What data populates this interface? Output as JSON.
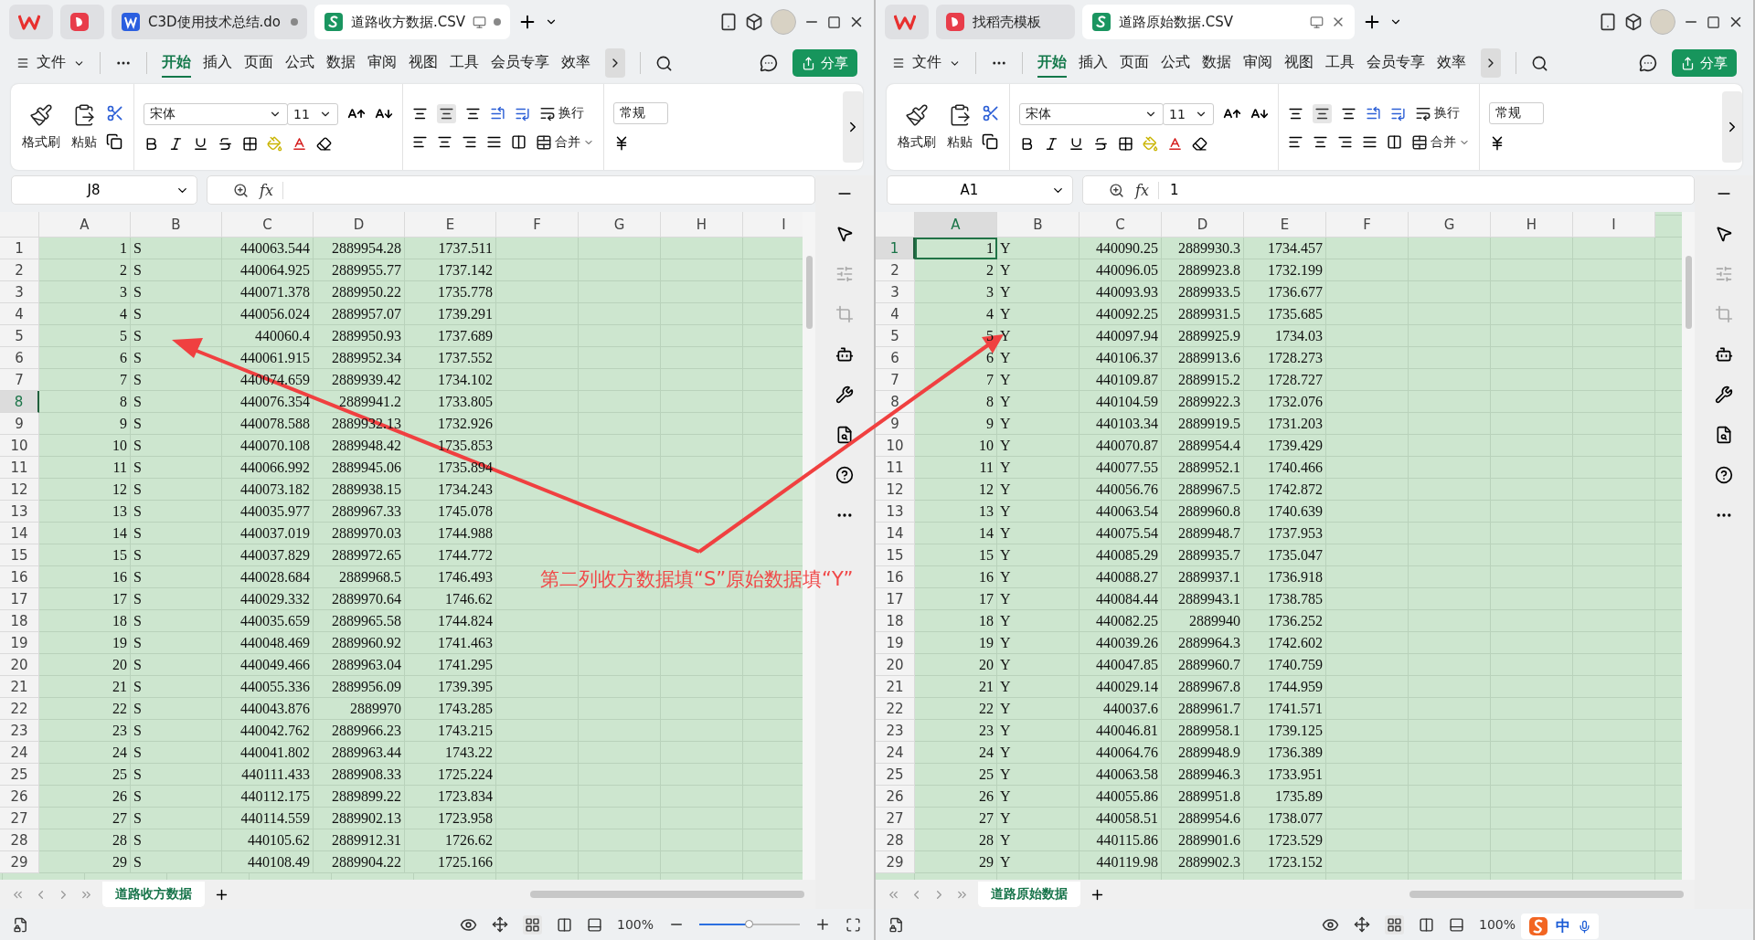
{
  "windows": [
    {
      "tabs": [
        {
          "kind": "wps",
          "selected": false
        },
        {
          "kind": "docer",
          "selected": false
        },
        {
          "kind": "writer",
          "label": "C3D使用技术总结.do",
          "selected": false,
          "unsaved": true
        },
        {
          "kind": "sheet",
          "label": "道路收方数据.CSV",
          "selected": true,
          "unsaved": true
        }
      ],
      "file_menu": "文件",
      "menu": [
        {
          "label": "开始",
          "selected": true
        },
        {
          "label": "插入",
          "selected": false
        },
        {
          "label": "页面",
          "selected": false
        },
        {
          "label": "公式",
          "selected": false
        },
        {
          "label": "数据",
          "selected": false
        },
        {
          "label": "审阅",
          "selected": false
        },
        {
          "label": "视图",
          "selected": false
        },
        {
          "label": "工具",
          "selected": false
        },
        {
          "label": "会员专享",
          "selected": false
        },
        {
          "label": "效率",
          "selected": false
        }
      ],
      "share": "分享",
      "ribbon": {
        "format_painter": "格式刷",
        "paste": "粘贴",
        "font": "宋体",
        "size": "11",
        "wrap": "换行",
        "merge": "合并",
        "number_format": "常规"
      },
      "name_box": "J8",
      "formula_label": "fx",
      "columns": [
        {
          "label": "A",
          "selected": false
        },
        {
          "label": "B",
          "selected": false
        },
        {
          "label": "C",
          "selected": false
        },
        {
          "label": "D",
          "selected": false
        },
        {
          "label": "E",
          "selected": false
        },
        {
          "label": "F",
          "selected": false
        },
        {
          "label": "G",
          "selected": false
        },
        {
          "label": "H",
          "selected": false
        },
        {
          "label": "I",
          "selected": false
        }
      ],
      "rows": [
        {
          "number": "1",
          "selected": false,
          "cells": [
            "1",
            "S",
            "440063.544",
            "2889954.28",
            "1737.511"
          ]
        },
        {
          "number": "2",
          "selected": false,
          "cells": [
            "2",
            "S",
            "440064.925",
            "2889955.77",
            "1737.142"
          ]
        },
        {
          "number": "3",
          "selected": false,
          "cells": [
            "3",
            "S",
            "440071.378",
            "2889950.22",
            "1735.778"
          ]
        },
        {
          "number": "4",
          "selected": false,
          "cells": [
            "4",
            "S",
            "440056.024",
            "2889957.07",
            "1739.291"
          ]
        },
        {
          "number": "5",
          "selected": false,
          "cells": [
            "5",
            "S",
            "440060.4",
            "2889950.93",
            "1737.689"
          ]
        },
        {
          "number": "6",
          "selected": false,
          "cells": [
            "6",
            "S",
            "440061.915",
            "2889952.34",
            "1737.552"
          ]
        },
        {
          "number": "7",
          "selected": false,
          "cells": [
            "7",
            "S",
            "440074.659",
            "2889939.42",
            "1734.102"
          ]
        },
        {
          "number": "8",
          "selected": true,
          "cells": [
            "8",
            "S",
            "440076.354",
            "2889941.2",
            "1733.805"
          ]
        },
        {
          "number": "9",
          "selected": false,
          "cells": [
            "9",
            "S",
            "440078.588",
            "2889932.13",
            "1732.926"
          ]
        },
        {
          "number": "10",
          "selected": false,
          "cells": [
            "10",
            "S",
            "440070.108",
            "2889948.42",
            "1735.853"
          ]
        },
        {
          "number": "11",
          "selected": false,
          "cells": [
            "11",
            "S",
            "440066.992",
            "2889945.06",
            "1735.894"
          ]
        },
        {
          "number": "12",
          "selected": false,
          "cells": [
            "12",
            "S",
            "440073.182",
            "2889938.15",
            "1734.243"
          ]
        },
        {
          "number": "13",
          "selected": false,
          "cells": [
            "13",
            "S",
            "440035.977",
            "2889967.33",
            "1745.078"
          ]
        },
        {
          "number": "14",
          "selected": false,
          "cells": [
            "14",
            "S",
            "440037.019",
            "2889970.03",
            "1744.988"
          ]
        },
        {
          "number": "15",
          "selected": false,
          "cells": [
            "15",
            "S",
            "440037.829",
            "2889972.65",
            "1744.772"
          ]
        },
        {
          "number": "16",
          "selected": false,
          "cells": [
            "16",
            "S",
            "440028.684",
            "2889968.5",
            "1746.493"
          ]
        },
        {
          "number": "17",
          "selected": false,
          "cells": [
            "17",
            "S",
            "440029.332",
            "2889970.64",
            "1746.62"
          ]
        },
        {
          "number": "18",
          "selected": false,
          "cells": [
            "18",
            "S",
            "440035.659",
            "2889965.58",
            "1744.824"
          ]
        },
        {
          "number": "19",
          "selected": false,
          "cells": [
            "19",
            "S",
            "440048.469",
            "2889960.92",
            "1741.463"
          ]
        },
        {
          "number": "20",
          "selected": false,
          "cells": [
            "20",
            "S",
            "440049.466",
            "2889963.04",
            "1741.295"
          ]
        },
        {
          "number": "21",
          "selected": false,
          "cells": [
            "21",
            "S",
            "440055.336",
            "2889956.09",
            "1739.395"
          ]
        },
        {
          "number": "22",
          "selected": false,
          "cells": [
            "22",
            "S",
            "440043.876",
            "2889970",
            "1743.285"
          ]
        },
        {
          "number": "23",
          "selected": false,
          "cells": [
            "23",
            "S",
            "440042.762",
            "2889966.23",
            "1743.215"
          ]
        },
        {
          "number": "24",
          "selected": false,
          "cells": [
            "24",
            "S",
            "440041.802",
            "2889963.44",
            "1743.22"
          ]
        },
        {
          "number": "25",
          "selected": false,
          "cells": [
            "25",
            "S",
            "440111.433",
            "2889908.33",
            "1725.224"
          ]
        },
        {
          "number": "26",
          "selected": false,
          "cells": [
            "26",
            "S",
            "440112.175",
            "2889899.22",
            "1723.834"
          ]
        },
        {
          "number": "27",
          "selected": false,
          "cells": [
            "27",
            "S",
            "440114.559",
            "2889902.13",
            "1723.958"
          ]
        },
        {
          "number": "28",
          "selected": false,
          "cells": [
            "28",
            "S",
            "440105.62",
            "2889912.31",
            "1726.62"
          ]
        },
        {
          "number": "29",
          "selected": false,
          "cells": [
            "29",
            "S",
            "440108.49",
            "2889904.22",
            "1725.166"
          ]
        }
      ],
      "sheet_tabs": [
        {
          "label": "道路收方数据",
          "selected": true
        }
      ],
      "zoom": {
        "label": "100%",
        "level": 0.5
      }
    },
    {
      "tabs": [
        {
          "kind": "wps",
          "selected": false
        },
        {
          "kind": "docer",
          "label": "找稻壳模板",
          "selected": false
        },
        {
          "kind": "sheet",
          "label": "道路原始数据.CSV",
          "selected": true,
          "unsaved": false
        }
      ],
      "file_menu": "文件",
      "menu": [
        {
          "label": "开始",
          "selected": true
        },
        {
          "label": "插入",
          "selected": false
        },
        {
          "label": "页面",
          "selected": false
        },
        {
          "label": "公式",
          "selected": false
        },
        {
          "label": "数据",
          "selected": false
        },
        {
          "label": "审阅",
          "selected": false
        },
        {
          "label": "视图",
          "selected": false
        },
        {
          "label": "工具",
          "selected": false
        },
        {
          "label": "会员专享",
          "selected": false
        },
        {
          "label": "效率",
          "selected": false
        }
      ],
      "share": "分享",
      "ribbon": {
        "format_painter": "格式刷",
        "paste": "粘贴",
        "font": "宋体",
        "size": "11",
        "wrap": "换行",
        "merge": "合并",
        "number_format": "常规"
      },
      "name_box": "A1",
      "formula_label": "fx",
      "formula": "1",
      "columns": [
        {
          "label": "A",
          "selected": true
        },
        {
          "label": "B",
          "selected": false
        },
        {
          "label": "C",
          "selected": false
        },
        {
          "label": "D",
          "selected": false
        },
        {
          "label": "E",
          "selected": false
        },
        {
          "label": "F",
          "selected": false
        },
        {
          "label": "G",
          "selected": false
        },
        {
          "label": "H",
          "selected": false
        },
        {
          "label": "I",
          "selected": false
        }
      ],
      "rows": [
        {
          "number": "1",
          "selected": true,
          "cells": [
            "1",
            "Y",
            "440090.25",
            "2889930.3",
            "1734.457"
          ]
        },
        {
          "number": "2",
          "selected": false,
          "cells": [
            "2",
            "Y",
            "440096.05",
            "2889923.8",
            "1732.199"
          ]
        },
        {
          "number": "3",
          "selected": false,
          "cells": [
            "3",
            "Y",
            "440093.93",
            "2889933.5",
            "1736.677"
          ]
        },
        {
          "number": "4",
          "selected": false,
          "cells": [
            "4",
            "Y",
            "440092.25",
            "2889931.5",
            "1735.685"
          ]
        },
        {
          "number": "5",
          "selected": false,
          "cells": [
            "5",
            "Y",
            "440097.94",
            "2889925.9",
            "1734.03"
          ]
        },
        {
          "number": "6",
          "selected": false,
          "cells": [
            "6",
            "Y",
            "440106.37",
            "2889913.6",
            "1728.273"
          ]
        },
        {
          "number": "7",
          "selected": false,
          "cells": [
            "7",
            "Y",
            "440109.87",
            "2889915.2",
            "1728.727"
          ]
        },
        {
          "number": "8",
          "selected": false,
          "cells": [
            "8",
            "Y",
            "440104.59",
            "2889922.3",
            "1732.076"
          ]
        },
        {
          "number": "9",
          "selected": false,
          "cells": [
            "9",
            "Y",
            "440103.34",
            "2889919.5",
            "1731.203"
          ]
        },
        {
          "number": "10",
          "selected": false,
          "cells": [
            "10",
            "Y",
            "440070.87",
            "2889954.4",
            "1739.429"
          ]
        },
        {
          "number": "11",
          "selected": false,
          "cells": [
            "11",
            "Y",
            "440077.55",
            "2889952.1",
            "1740.466"
          ]
        },
        {
          "number": "12",
          "selected": false,
          "cells": [
            "12",
            "Y",
            "440056.76",
            "2889967.5",
            "1742.872"
          ]
        },
        {
          "number": "13",
          "selected": false,
          "cells": [
            "13",
            "Y",
            "440063.54",
            "2889960.8",
            "1740.639"
          ]
        },
        {
          "number": "14",
          "selected": false,
          "cells": [
            "14",
            "Y",
            "440075.54",
            "2889948.7",
            "1737.953"
          ]
        },
        {
          "number": "15",
          "selected": false,
          "cells": [
            "15",
            "Y",
            "440085.29",
            "2889935.7",
            "1735.047"
          ]
        },
        {
          "number": "16",
          "selected": false,
          "cells": [
            "16",
            "Y",
            "440088.27",
            "2889937.1",
            "1736.918"
          ]
        },
        {
          "number": "17",
          "selected": false,
          "cells": [
            "17",
            "Y",
            "440084.44",
            "2889943.1",
            "1738.785"
          ]
        },
        {
          "number": "18",
          "selected": false,
          "cells": [
            "18",
            "Y",
            "440082.25",
            "2889940",
            "1736.252"
          ]
        },
        {
          "number": "19",
          "selected": false,
          "cells": [
            "19",
            "Y",
            "440039.26",
            "2889964.3",
            "1742.602"
          ]
        },
        {
          "number": "20",
          "selected": false,
          "cells": [
            "20",
            "Y",
            "440047.85",
            "2889960.7",
            "1740.759"
          ]
        },
        {
          "number": "21",
          "selected": false,
          "cells": [
            "21",
            "Y",
            "440029.14",
            "2889967.8",
            "1744.959"
          ]
        },
        {
          "number": "22",
          "selected": false,
          "cells": [
            "22",
            "Y",
            "440037.6",
            "2889961.7",
            "1741.571"
          ]
        },
        {
          "number": "23",
          "selected": false,
          "cells": [
            "23",
            "Y",
            "440046.81",
            "2889958.1",
            "1739.125"
          ]
        },
        {
          "number": "24",
          "selected": false,
          "cells": [
            "24",
            "Y",
            "440064.76",
            "2889948.9",
            "1736.389"
          ]
        },
        {
          "number": "25",
          "selected": false,
          "cells": [
            "25",
            "Y",
            "440063.58",
            "2889946.3",
            "1733.951"
          ]
        },
        {
          "number": "26",
          "selected": false,
          "cells": [
            "26",
            "Y",
            "440055.86",
            "2889951.8",
            "1735.89"
          ]
        },
        {
          "number": "27",
          "selected": false,
          "cells": [
            "27",
            "Y",
            "440058.51",
            "2889954.6",
            "1738.077"
          ]
        },
        {
          "number": "28",
          "selected": false,
          "cells": [
            "28",
            "Y",
            "440115.86",
            "2889901.6",
            "1723.529"
          ]
        },
        {
          "number": "29",
          "selected": false,
          "cells": [
            "29",
            "Y",
            "440119.98",
            "2889902.3",
            "1723.152"
          ]
        }
      ],
      "sheet_tabs": [
        {
          "label": "道路原始数据",
          "selected": true
        }
      ],
      "zoom": {
        "label": "100%"
      }
    }
  ],
  "annotation": {
    "text": "第二列收方数据填“S”原始数据填“Y”"
  },
  "ime": {
    "label": "中"
  }
}
